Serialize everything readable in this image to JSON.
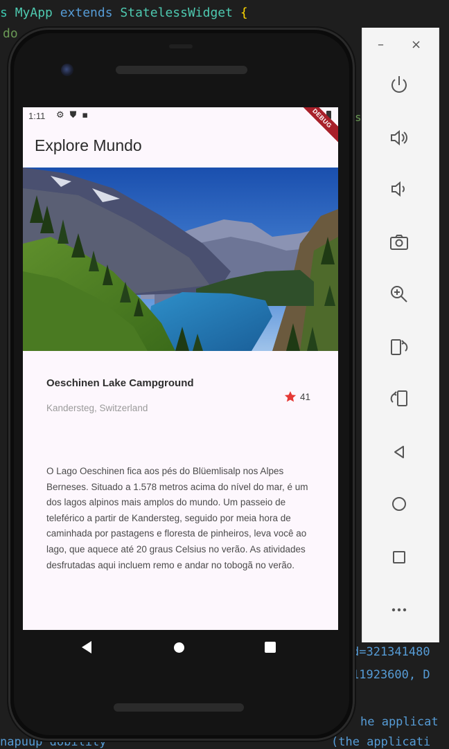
{
  "editor": {
    "line1_prefix": "s ",
    "line1_class": "MyApp",
    "line1_extends": " extends ",
    "line1_super": "StatelessWidget",
    "line1_brace": " {",
    "line2": "do",
    "console_line1": "d=321341480",
    "console_line2": "11923600, D",
    "console_line3": "he applicat",
    "console_line4_left": "napuup dobility",
    "console_line4_right": "(the applicati"
  },
  "status_bar": {
    "time": "1:11",
    "icons": [
      "gear-icon",
      "shield-icon",
      "sim-icon"
    ],
    "debug_label": "DEBUG"
  },
  "app_bar": {
    "title": "Explore Mundo"
  },
  "place": {
    "name": "Oeschinen Lake Campground",
    "location": "Kandersteg, Switzerland",
    "rating_count": "41",
    "star_color": "#e53935"
  },
  "description": "O Lago Oeschinen fica aos pés do Blüemlisalp nos Alpes Berneses. Situado a 1.578 metros acima do nível do mar, é um dos lagos alpinos mais amplos do mundo. Um passeio de teleférico a partir de Kandersteg, seguido por meia hora de caminhada por pastagens e floresta de pinheiros, leva você ao lago, que aquece até 20 graus Celsius no verão. As atividades desfrutadas aqui incluem remo e andar no tobogã no verão.",
  "nav_bar": {
    "buttons": [
      "back-icon",
      "home-icon",
      "recents-icon"
    ]
  },
  "emulator_toolbar": {
    "minimize_label": "–",
    "close_label": "×",
    "buttons": [
      "power-icon",
      "volume-up-icon",
      "volume-down-icon",
      "camera-icon",
      "zoom-in-icon",
      "rotate-right-icon",
      "rotate-left-icon",
      "back-icon",
      "home-icon",
      "overview-icon",
      "more-icon"
    ]
  }
}
